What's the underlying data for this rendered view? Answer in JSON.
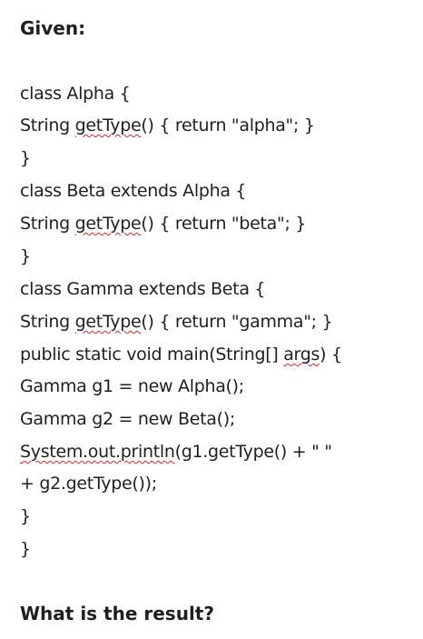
{
  "heading": "Given:",
  "code": {
    "l1": "class Alpha {",
    "l2_pre": "String ",
    "l2_sq": "getType",
    "l2_post": "() { return \"alpha\"; }",
    "l3": "}",
    "l4": "class Beta extends Alpha {",
    "l5_pre": "String ",
    "l5_sq": "getType",
    "l5_post": "() { return \"beta\"; }",
    "l6": "}",
    "l7": "class Gamma extends Beta {",
    "l8_pre": "String ",
    "l8_sq": "getType",
    "l8_post": "() { return \"gamma\"; }",
    "l9_pre": "public static void main(String[] ",
    "l9_sq": "args",
    "l9_post": ") {",
    "l10": "Gamma g1 = new Alpha();",
    "l11": "Gamma g2 = new Beta();",
    "l12_sq": "System.out.println",
    "l12_post": "(g1.getType() + \" \"",
    "l13": "+ g2.getType());",
    "l14": "}",
    "l15": "}"
  },
  "question": "What is the result?",
  "colors": {
    "text": "#1f1f1f",
    "spellcheck_squiggle": "#d62828",
    "background": "#ffffff"
  }
}
